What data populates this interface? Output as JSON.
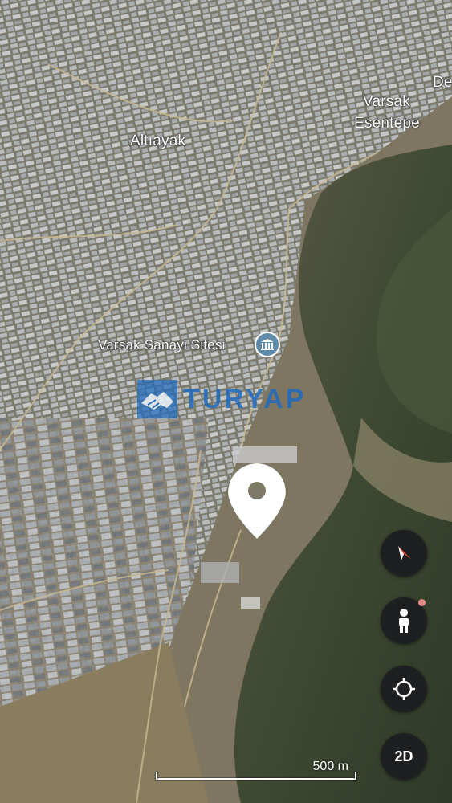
{
  "map": {
    "place_labels": [
      {
        "id": "altiayak",
        "text": "Altıayak"
      },
      {
        "id": "varsak",
        "text": "Varsak"
      },
      {
        "id": "esentepe",
        "text": "Esentepe"
      },
      {
        "id": "de",
        "text": "De"
      },
      {
        "id": "sanayi",
        "text": "Varsak Sanayi Sitesi"
      }
    ],
    "poi_icon": "government-building-icon",
    "watermark": {
      "text": "TURYAP",
      "icon": "handshake-icon"
    },
    "pin_icon": "location-pin-icon",
    "scale": "500 m"
  },
  "controls": {
    "compass_icon": "compass-icon",
    "streetview_icon": "pegman-icon",
    "locate_icon": "my-location-icon",
    "view_toggle": "2D"
  },
  "colors": {
    "control_bg": "#1d1f20",
    "watermark_blue": "#1f6bbf",
    "compass_red": "#e8473b",
    "notification_dot": "#e98a8a"
  }
}
